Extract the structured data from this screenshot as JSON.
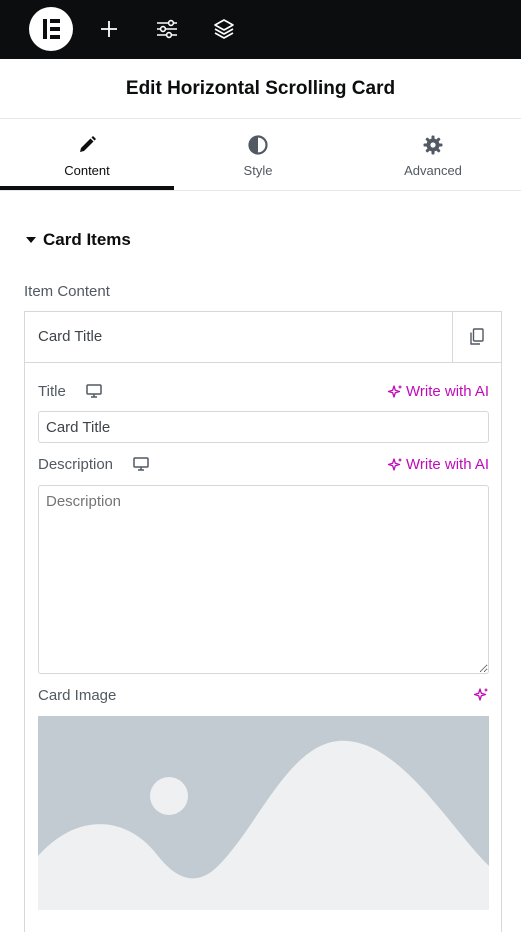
{
  "toolbar": {
    "logo_icon": "elementor-logo-icon",
    "buttons": [
      "add-icon",
      "sliders-icon",
      "layers-icon"
    ]
  },
  "header": {
    "title": "Edit Horizontal Scrolling Card"
  },
  "tabs": [
    {
      "label": "Content",
      "icon": "pencil-icon",
      "active": true
    },
    {
      "label": "Style",
      "icon": "contrast-icon",
      "active": false
    },
    {
      "label": "Advanced",
      "icon": "gear-icon",
      "active": false
    }
  ],
  "section": {
    "label": "Card Items"
  },
  "item_content": {
    "label": "Item Content",
    "repeater_title": "Card Title",
    "fields": {
      "title": {
        "label": "Title",
        "value": "Card Title",
        "ai_label": "Write with AI"
      },
      "description": {
        "label": "Description",
        "placeholder": "Description",
        "ai_label": "Write with AI"
      },
      "image": {
        "label": "Card Image"
      }
    }
  },
  "colors": {
    "accent_ai": "#c00bb9",
    "topbar": "#0c0d0e",
    "placeholder_bg": "#c2cbd2"
  }
}
